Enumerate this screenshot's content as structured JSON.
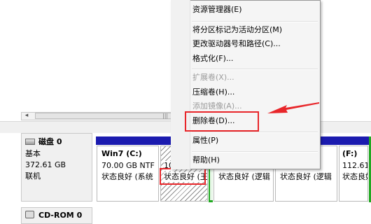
{
  "context_menu": {
    "items": [
      {
        "label": "资源管理器(E)",
        "disabled": false
      },
      {
        "label": "将分区标记为活动分区(M)",
        "disabled": false
      },
      {
        "label": "更改驱动器号和路径(C)...",
        "disabled": false
      },
      {
        "label": "格式化(F)...",
        "disabled": false
      },
      {
        "label": "扩展卷(X)...",
        "disabled": true
      },
      {
        "label": "压缩卷(H)...",
        "disabled": false
      },
      {
        "label": "添加镜像(A)...",
        "disabled": true
      },
      {
        "label": "删除卷(D)...",
        "disabled": false,
        "highlighted": true
      },
      {
        "label": "属性(P)",
        "disabled": false
      },
      {
        "label": "帮助(H)",
        "disabled": false
      }
    ]
  },
  "disk0": {
    "name": "磁盘 0",
    "type": "基本",
    "size": "372.61 GB",
    "status": "联机"
  },
  "partitions": [
    {
      "title": "Win7  (C:)",
      "size": "70.00 GB NTF",
      "status": "状态良好 (系统"
    },
    {
      "title": "",
      "size": "10",
      "status": "状态良好 (王"
    },
    {
      "title": "",
      "size": "",
      "status": "状态良好 (逻辑"
    },
    {
      "title": "",
      "size": "",
      "status": "状态良好 (逻辑"
    },
    {
      "title": "(F:)",
      "size": "112.61",
      "status": "状态良好"
    }
  ],
  "cdrom": {
    "name": "CD-ROM 0"
  },
  "colors": {
    "partition_bar": "#1b1baf",
    "extended_frame": "#21a821",
    "annotation_red": "#e8262a"
  }
}
